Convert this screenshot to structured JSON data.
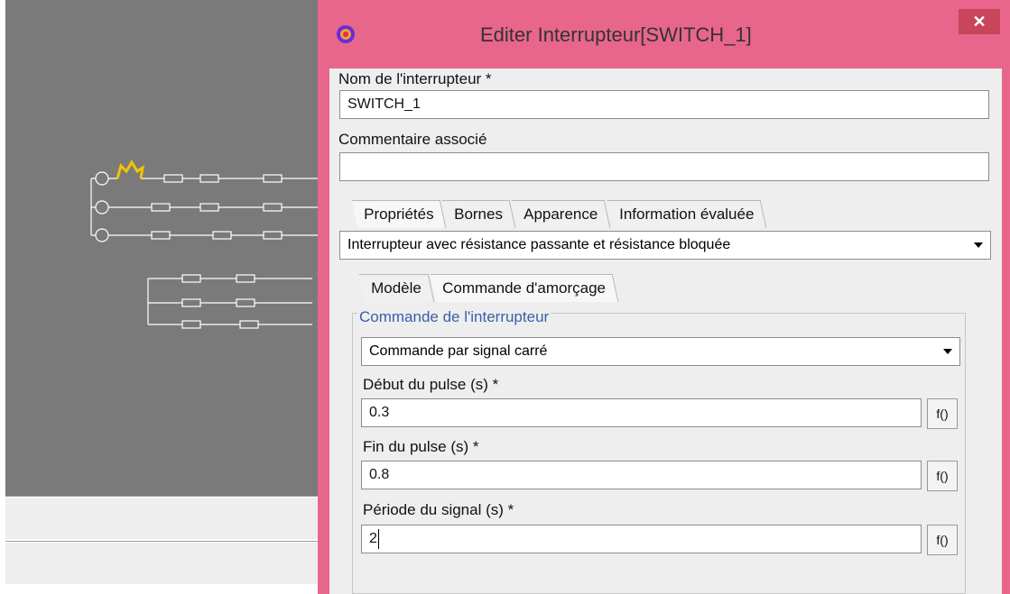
{
  "dialog": {
    "title": "Editer Interrupteur[SWITCH_1]",
    "close_symbol": "✕",
    "name_label": "Nom de l'interrupteur *",
    "name_value": "SWITCH_1",
    "comment_label": "Commentaire associé",
    "comment_value": "",
    "tabs": [
      "Propriétés",
      "Bornes",
      "Apparence",
      "Information évaluée"
    ],
    "switch_type": "Interrupteur avec résistance passante et résistance bloquée",
    "subtabs": [
      "Modèle",
      "Commande d'amorçage"
    ],
    "group_title": "Commande de l'interrupteur",
    "command_type": "Commande par signal carré",
    "pulse_start_label": "Début du pulse (s) *",
    "pulse_start_value": "0.3",
    "pulse_end_label": "Fin du pulse (s) *",
    "pulse_end_value": "0.8",
    "period_label": "Période du signal (s) *",
    "period_value": "2",
    "function_button": "f()"
  },
  "colors": {
    "titlebar": "#e8668c",
    "close": "#c8455b",
    "canvas": "#7a7a7a",
    "switch_highlight": "#f5c400"
  },
  "icons": {
    "app": "app-logo-icon",
    "close": "close-icon",
    "dropdown": "chevron-down-icon",
    "voltage_source": "voltage-source-icon"
  }
}
